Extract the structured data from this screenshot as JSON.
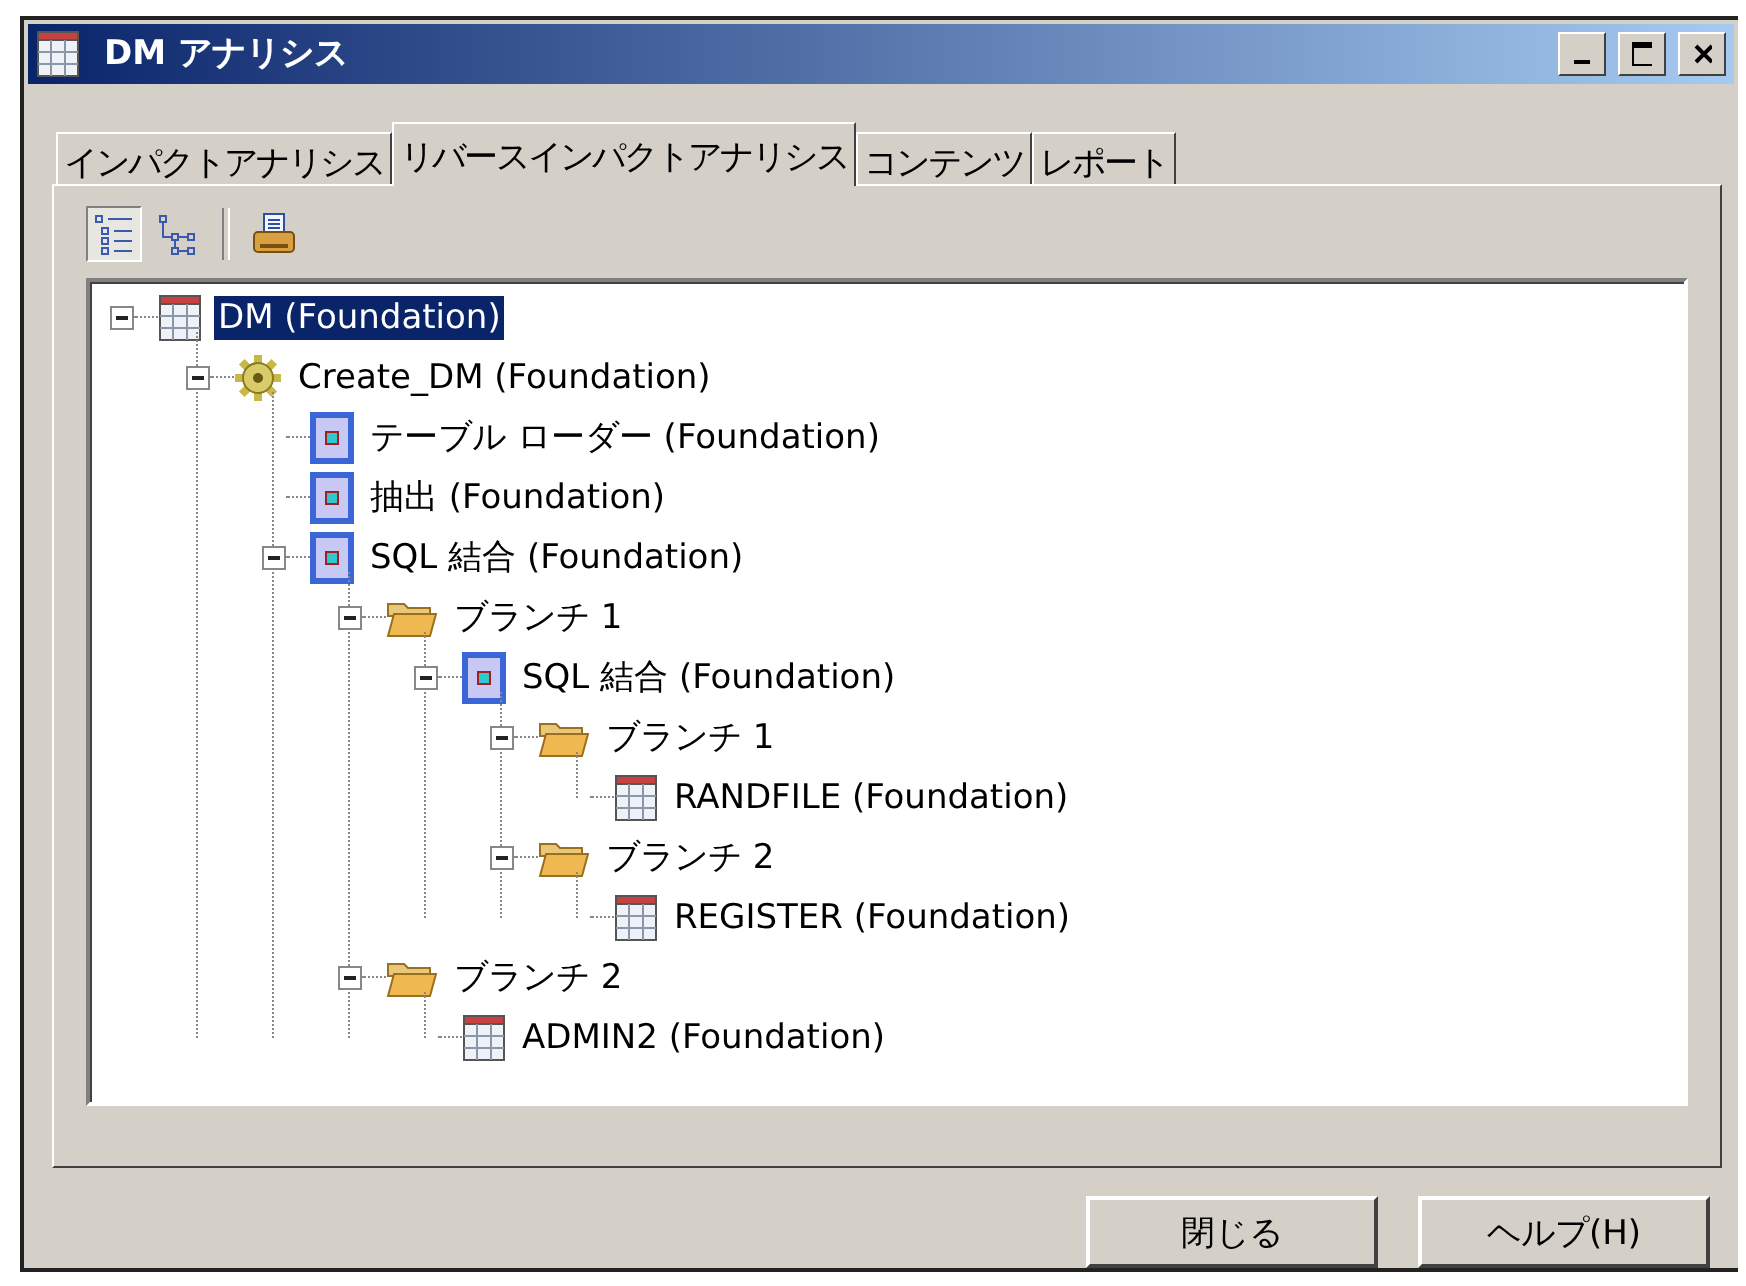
{
  "window": {
    "title": "DM アナリシス"
  },
  "tabs": [
    {
      "label": "インパクトアナリシス",
      "selected": false
    },
    {
      "label": "リバースインパクトアナリシス",
      "selected": true
    },
    {
      "label": "コンテンツ",
      "selected": false
    },
    {
      "label": "レポート",
      "selected": false
    }
  ],
  "toolbar": [
    {
      "kind": "tree-view",
      "selected": true
    },
    {
      "kind": "diagram-view",
      "selected": false
    },
    {
      "kind": "separator"
    },
    {
      "kind": "print",
      "selected": false
    }
  ],
  "tree": [
    {
      "label": "DM (Foundation)",
      "kind": "table",
      "selected": true,
      "expanded": true,
      "children": [
        {
          "label": "Create_DM (Foundation)",
          "kind": "job",
          "selected": false,
          "expanded": true,
          "children": [
            {
              "label": "テーブル ローダー (Foundation)",
              "kind": "transform",
              "selected": false
            },
            {
              "label": "抽出 (Foundation)",
              "kind": "transform",
              "selected": false
            },
            {
              "label": "SQL 結合 (Foundation)",
              "kind": "transform",
              "selected": false,
              "expanded": true,
              "children": [
                {
                  "label": "ブランチ 1",
                  "kind": "folder",
                  "selected": false,
                  "expanded": true,
                  "children": [
                    {
                      "label": "SQL 結合 (Foundation)",
                      "kind": "transform",
                      "selected": false,
                      "expanded": true,
                      "children": [
                        {
                          "label": "ブランチ 1",
                          "kind": "folder",
                          "selected": false,
                          "expanded": true,
                          "children": [
                            {
                              "label": "RANDFILE (Foundation)",
                              "kind": "table",
                              "selected": false
                            }
                          ]
                        },
                        {
                          "label": "ブランチ 2",
                          "kind": "folder",
                          "selected": false,
                          "expanded": true,
                          "children": [
                            {
                              "label": "REGISTER (Foundation)",
                              "kind": "table",
                              "selected": false
                            }
                          ]
                        }
                      ]
                    }
                  ]
                },
                {
                  "label": "ブランチ 2",
                  "kind": "folder",
                  "selected": false,
                  "expanded": true,
                  "children": [
                    {
                      "label": "ADMIN2 (Foundation)",
                      "kind": "table",
                      "selected": false
                    }
                  ]
                }
              ]
            }
          ]
        }
      ]
    }
  ],
  "buttons": [
    {
      "label": "閉じる"
    },
    {
      "label": "ヘルプ(H)"
    }
  ]
}
